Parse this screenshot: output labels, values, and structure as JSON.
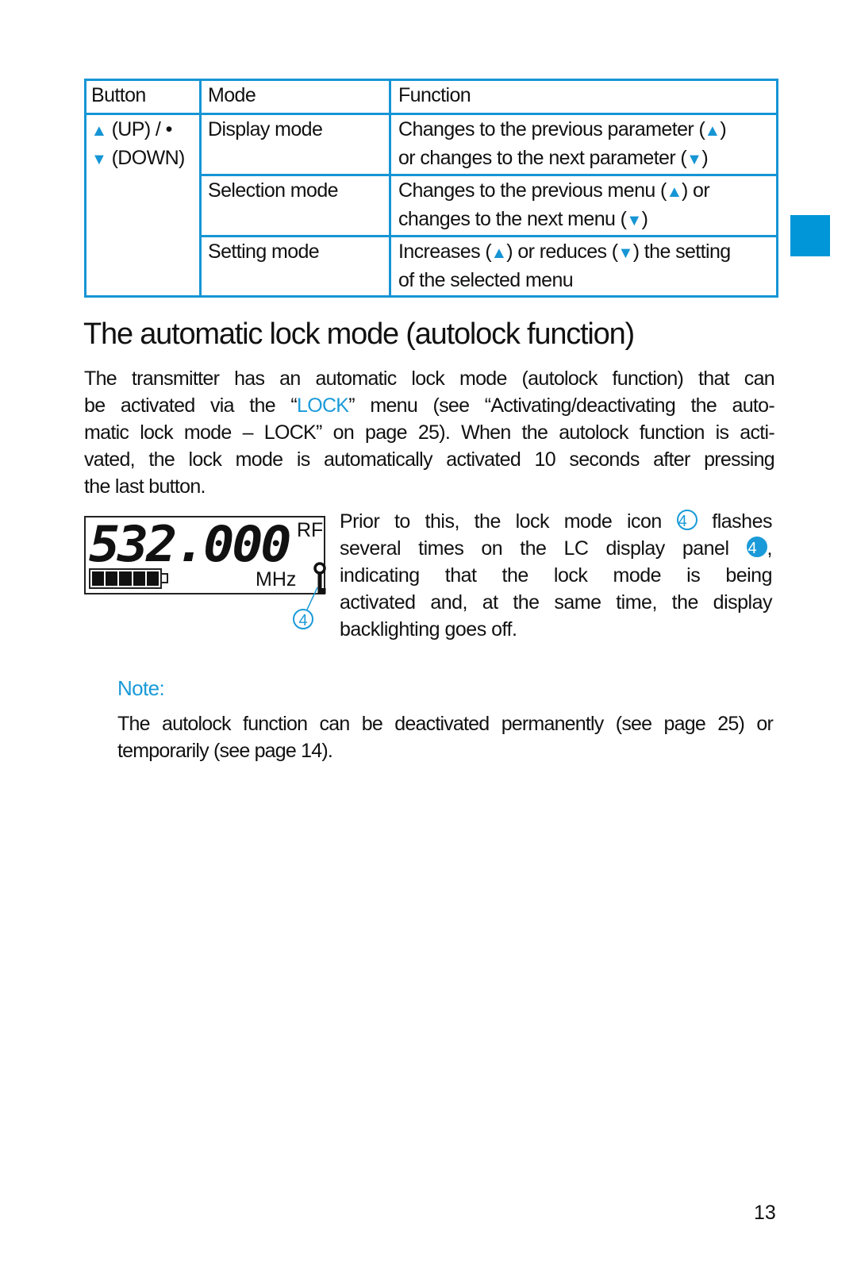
{
  "table": {
    "headers": [
      "Button",
      "Mode",
      "Function"
    ],
    "button_cell": {
      "up_label": "(UP) / •",
      "down_label": "(DOWN)"
    },
    "rows": [
      {
        "mode": "Display mode",
        "function_line1_pre": "Changes to the previous parameter (",
        "function_line1_post": ")",
        "function_line2_pre": "or changes to the next parameter (",
        "function_line2_post": ")"
      },
      {
        "mode": "Selection mode",
        "function_line1_pre": "Changes to the previous menu (",
        "function_line1_post": ") or",
        "function_line2_pre": "changes to the next menu (",
        "function_line2_post": ")"
      },
      {
        "mode": "Setting mode",
        "function_line1_pre": "Increases (",
        "function_line1_mid": ") or reduces (",
        "function_line1_post": ") the setting",
        "function_line2": "of the selected menu"
      }
    ],
    "icons": {
      "up": "▲",
      "down": "▼"
    }
  },
  "section": {
    "heading": "The automatic lock mode (autolock function)",
    "paragraph": {
      "line1": "The transmitter has an automatic lock mode (autolock function) that can",
      "line2_pre": "be activated via the “",
      "line2_link": "LOCK",
      "line2_post": "” menu (see “Activating/deactivating the auto-",
      "line3": "matic lock mode – LOCK” on page 25). When the autolock function is acti-",
      "line4": "vated, the lock mode is automatically activated 10 seconds after pressing",
      "line5": "the last button."
    }
  },
  "lcd": {
    "frequency": "532.000",
    "rf_label": "RF",
    "unit_label": "MHz",
    "battery_level_fraction": 1.0,
    "battery_segments": 5,
    "callout_number": "4"
  },
  "side_paragraph": {
    "line1_pre": "Prior to this, the lock mode icon",
    "line1_callout": "4",
    "line1_post": "flashes",
    "line2_pre": "several times on the LC display panel",
    "line2_callout": "4",
    "line2_post": ",",
    "line3": "indicating that the lock mode is being",
    "line4": "activated and, at the same time, the display",
    "line5": "backlighting goes off."
  },
  "note": {
    "label": "Note:",
    "line1": "The autolock function can be deactivated permanently (see page 25) or",
    "line2": "temporarily (see page 14)."
  },
  "page_number": "13",
  "colors": {
    "accent": "#1a9ad8",
    "table_border": "#1695d5",
    "side_tab": "#0096d8"
  }
}
